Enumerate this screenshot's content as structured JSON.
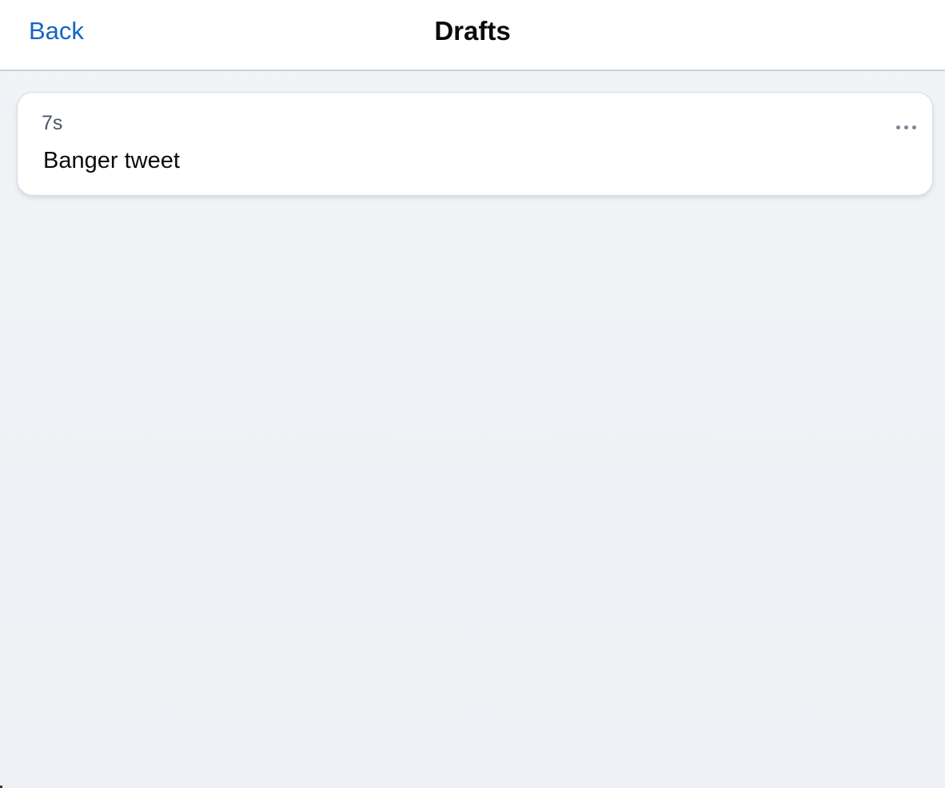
{
  "header": {
    "back_label": "Back",
    "title": "Drafts"
  },
  "drafts": [
    {
      "time": "7s",
      "text": "Banger tweet",
      "more_icon": "more-horizontal-icon"
    }
  ],
  "colors": {
    "accent": "#1565c7",
    "background": "#eef1f5",
    "card": "#ffffff",
    "muted_text": "#485566",
    "icon": "#7b8796"
  }
}
